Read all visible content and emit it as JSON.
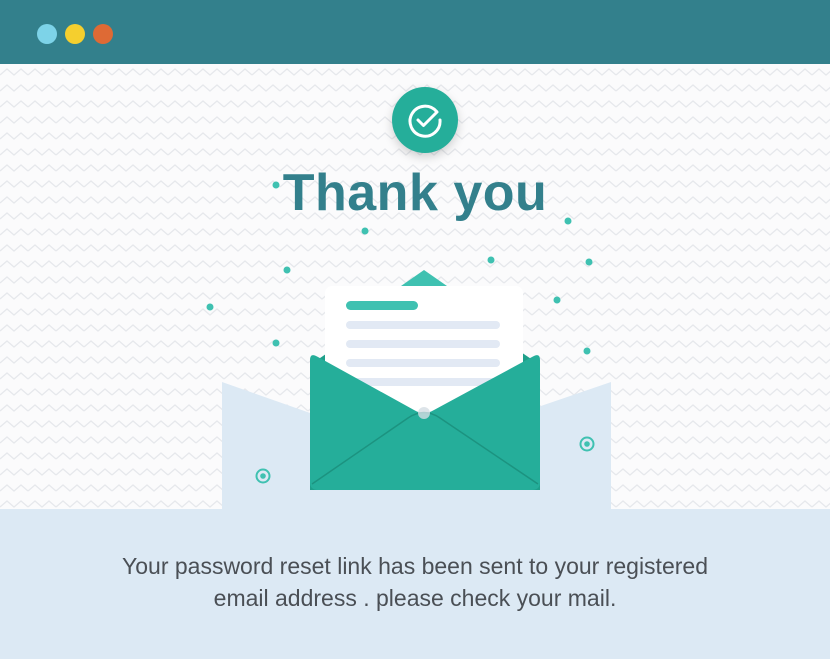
{
  "window": {
    "controls": [
      "close",
      "minimize",
      "maximize"
    ],
    "colors": {
      "titlebar": "#33808c",
      "close": "#7dd3e8",
      "minimize": "#f5cf2e",
      "maximize": "#de6a35"
    }
  },
  "confirmation": {
    "icon": "check-circle-icon",
    "title": "Thank you",
    "accent_color": "#25ae9a",
    "title_color": "#33808c"
  },
  "illustration": {
    "icon": "open-envelope-with-letter"
  },
  "message": {
    "line1": "Your password reset link has been sent to your registered",
    "line2": "email address . please check your mail."
  }
}
